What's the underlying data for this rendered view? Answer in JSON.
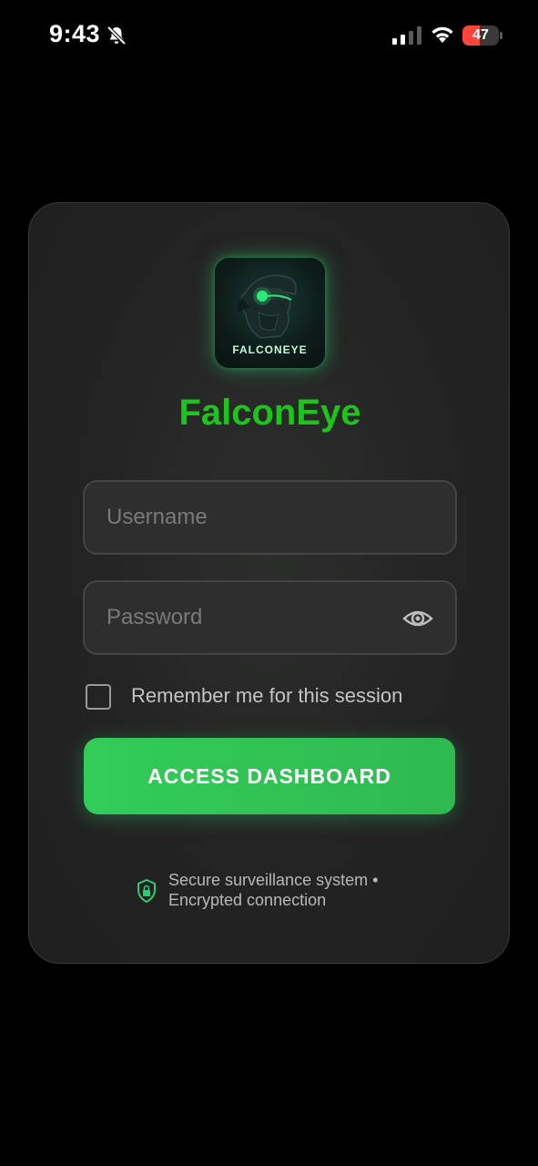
{
  "status_bar": {
    "time": "9:43",
    "battery_level": "47",
    "battery_fill_fraction": 0.47
  },
  "app": {
    "logo_text": "FALCONEYE",
    "title": "FalconEye"
  },
  "form": {
    "username_placeholder": "Username",
    "password_placeholder": "Password",
    "remember_label": "Remember me for this session",
    "remember_checked": false,
    "submit_label": "ACCESS DASHBOARD"
  },
  "footer": {
    "secure_line1": "Secure surveillance system •",
    "secure_line2": "Encrypted connection"
  },
  "colors": {
    "accent_green": "#1ec31e",
    "button_green": "#33cc5a",
    "background": "#000000",
    "card": "#232323"
  },
  "icons": {
    "bell": "bell-slash-icon",
    "signal": "cellular-signal-icon",
    "wifi": "wifi-icon",
    "battery": "battery-icon",
    "eye": "eye-icon",
    "shield": "lock-shield-icon"
  }
}
